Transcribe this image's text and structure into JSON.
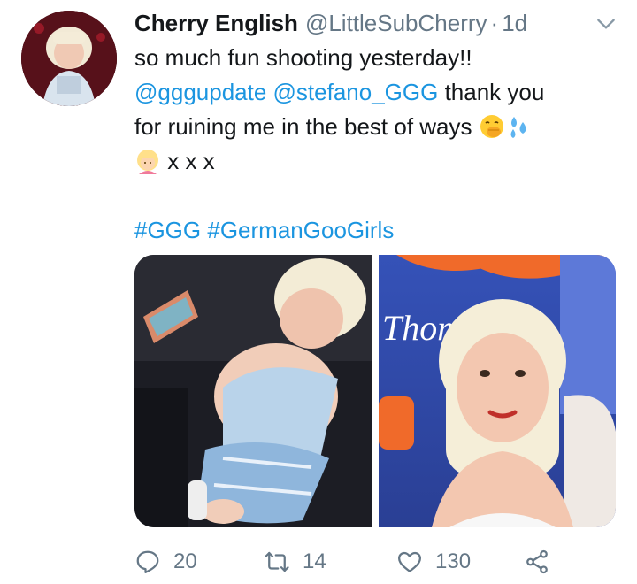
{
  "tweet": {
    "display_name": "Cherry English",
    "handle": "@LittleSubCherry",
    "separator": "·",
    "time": "1d",
    "text": {
      "line1": "so much fun shooting yesterday!!",
      "mention1": "@gggupdate",
      "mention2": "@stefano_GGG",
      "line2_rest": " thank you",
      "line3": "for ruining me in the best of ways ",
      "line4_rest": " x x x",
      "hashtag1": "#GGG",
      "hashtag2": "#GermanGooGirls"
    },
    "emojis": [
      "hand-over-mouth-emoji",
      "sweat-droplets-emoji",
      "blonde-person-emoji"
    ],
    "media": {
      "count": 2,
      "photo_backdrop_text": "Thom"
    },
    "stats": {
      "replies": "20",
      "retweets": "14",
      "likes": "130"
    }
  },
  "colors": {
    "link": "#1b95e0",
    "secondary_text": "#657786",
    "primary_text": "#14171a",
    "background": "#ffffff"
  },
  "icons": {
    "reply": "reply-icon",
    "retweet": "retweet-icon",
    "like": "heart-icon",
    "share": "share-icon",
    "menu": "chevron-down-icon"
  }
}
